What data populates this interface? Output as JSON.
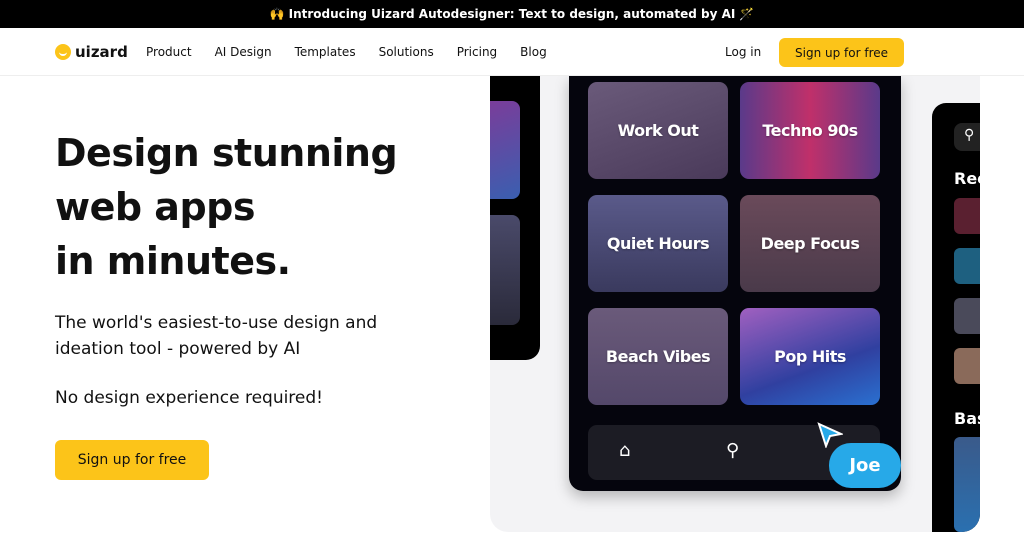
{
  "banner": {
    "emoji": "🙌",
    "text": "Introducing Uizard Autodesigner: Text to design, automated by AI",
    "trail_emoji": "🪄"
  },
  "nav": {
    "logo": "uizard",
    "links": [
      "Product",
      "AI Design",
      "Templates",
      "Solutions",
      "Pricing",
      "Blog"
    ],
    "login": "Log in",
    "signup": "Sign up for free"
  },
  "hero": {
    "title_lines": [
      "Design stunning",
      "web apps",
      "in minutes."
    ],
    "subtitle": "The world's easiest-to-use design and ideation tool - powered by AI",
    "note": "No design experience required!",
    "cta": "Sign up for free"
  },
  "mockup": {
    "tiles": [
      "Work Out",
      "Techno 90s",
      "Quiet Hours",
      "Deep Focus",
      "Beach Vibes",
      "Pop Hits"
    ],
    "right_labels": [
      "Rec",
      "Bas"
    ],
    "cursor_label": "Joe"
  },
  "colors": {
    "accent": "#fcc419",
    "cursor": "#27a9e8"
  }
}
